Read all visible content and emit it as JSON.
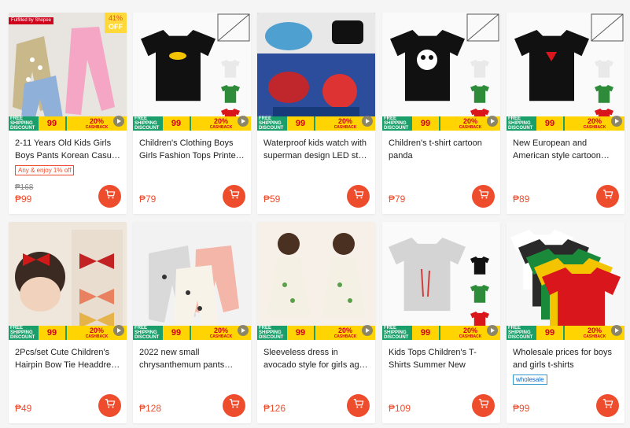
{
  "currency": "₱",
  "colors": {
    "accent": "#ee4d2d",
    "promo_green": "#1a9e6a",
    "promo_yellow": "#ffd400"
  },
  "promo": {
    "free_shipping": "FREE SHIPPING",
    "discount": "DISCOUNT",
    "amount": "99",
    "cashback_pct": "20%",
    "cashback": "CASHBACK"
  },
  "products": [
    {
      "title_line1": "2-11 Years Old Kids Girls",
      "title_line2": "Boys Pants Korean Casua…",
      "tag": "Any & enjoy 1% off",
      "old_price": "₱168",
      "price": "₱99",
      "discount_pct": "41%",
      "discount_label": "OFF",
      "fulfilled": "Fulfilled by Shopee",
      "image": "pants"
    },
    {
      "title_line1": "Children's Clothing Boys",
      "title_line2": "Girls Fashion Tops Printe…",
      "price": "₱79",
      "image": "tshirt-bat"
    },
    {
      "title_line1": "Waterproof kids watch with",
      "title_line2": "superman design LED strap",
      "price": "₱59",
      "image": "watches"
    },
    {
      "title_line1": "Children's t-shirt cartoon",
      "title_line2": "panda",
      "price": "₱79",
      "image": "tshirt-panda"
    },
    {
      "title_line1": "New European and",
      "title_line2": "American style cartoon…",
      "price": "₱89",
      "image": "tshirt-super"
    },
    {
      "title_line1": "2Pcs/set Cute Children's",
      "title_line2": "Hairpin Bow Tie Headdres…",
      "price": "₱49",
      "image": "bows"
    },
    {
      "title_line1": "2022 new small",
      "title_line2": "chrysanthemum pants…",
      "price": "₱128",
      "image": "pants2"
    },
    {
      "title_line1": "Sleeveless dress in",
      "title_line2": "avocado style for girls ag…",
      "price": "₱126",
      "image": "dress"
    },
    {
      "title_line1": "Kids Tops Children's T-",
      "title_line2": "Shirts Summer New",
      "price": "₱109",
      "image": "tshirt-flamingo"
    },
    {
      "title_line1": "Wholesale prices for boys",
      "title_line2": "and girls t-shirts",
      "tag": "wholesale",
      "price": "₱99",
      "image": "tshirts-stack"
    }
  ]
}
